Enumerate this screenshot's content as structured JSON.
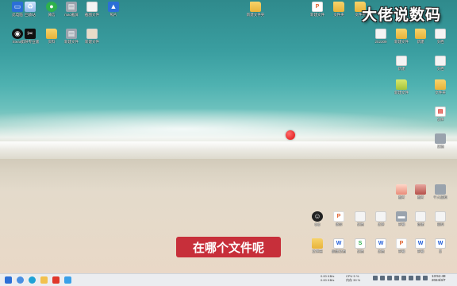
{
  "watermark": "大佬说数码",
  "subtitle": "在哪个文件呢",
  "desktop_icons": {
    "i01": {
      "label": "此电脑",
      "icon": "computer-icon"
    },
    "i02": {
      "label": "回收站",
      "icon": "recycle-bin-icon"
    },
    "i03": {
      "label": "微信",
      "icon": "wechat-icon"
    },
    "i04": {
      "label": "mac截屏",
      "icon": "screenshot-icon"
    },
    "i05": {
      "label": "截图文件",
      "icon": "document-icon"
    },
    "i06": {
      "label": "照片",
      "icon": "image-icon"
    },
    "i07": {
      "label": "新建文件夹",
      "icon": "folder-icon"
    },
    "i08": {
      "label": "新建文件",
      "icon": "ppt-icon"
    },
    "i09": {
      "label": "文件夹",
      "icon": "folder-icon"
    },
    "i10": {
      "label": "文件夹",
      "icon": "folder-icon"
    },
    "i11": {
      "label": "Steam",
      "icon": "steam-icon"
    },
    "i12": {
      "label": "剪映专业版",
      "icon": "capcut-icon"
    },
    "i13": {
      "label": "资料",
      "icon": "folder-icon"
    },
    "i14": {
      "label": "新建文件",
      "icon": "document-icon"
    },
    "i15": {
      "label": "新建文件",
      "icon": "document-icon"
    },
    "i16": {
      "label": "202309",
      "icon": "document-icon"
    },
    "i17": {
      "label": "新建文件",
      "icon": "folder-icon"
    },
    "i18": {
      "label": "新建",
      "icon": "document-icon"
    },
    "i19": {
      "label": "文档",
      "icon": "document-icon"
    },
    "i20": {
      "label": "新建文件",
      "icon": "folder-icon"
    },
    "i21": {
      "label": "文件",
      "icon": "pdf-icon"
    },
    "i22": {
      "label": "文件夹",
      "icon": "folder-icon"
    },
    "i23": {
      "label": "图片",
      "icon": "image-icon"
    },
    "i24": {
      "label": "个人资料",
      "icon": "image-icon"
    },
    "i25": {
      "label": "QQ",
      "icon": "qq-icon"
    },
    "i26": {
      "label": "演示",
      "icon": "ppt-icon"
    },
    "i27": {
      "label": "文档",
      "icon": "document-icon"
    },
    "i28": {
      "label": "文件",
      "icon": "document-icon"
    },
    "i29": {
      "label": "字幕",
      "icon": "document-icon"
    },
    "i30": {
      "label": "新建",
      "icon": "document-icon"
    },
    "i31": {
      "label": "资料",
      "icon": "document-icon"
    },
    "i32": {
      "label": "文件夹",
      "icon": "folder-icon"
    },
    "i33": {
      "label": "新建文档",
      "icon": "word-icon"
    },
    "i34": {
      "label": "文档",
      "icon": "word-icon"
    },
    "i35": {
      "label": "文档",
      "icon": "word-icon"
    },
    "i36": {
      "label": "字幕",
      "icon": "ppt-icon"
    },
    "i37": {
      "label": "字幕",
      "icon": "word-icon"
    },
    "i38": {
      "label": "文",
      "icon": "word-icon"
    }
  },
  "taskbar": {
    "net_up": "0.00 KB/s",
    "net_down": "0.00 KB/s",
    "cpu": "CPU 5 %",
    "mem": "内存 39 %",
    "time": "13:51:48",
    "date": "2024/3/7"
  },
  "colors": {
    "accent": "#c72f3a",
    "taskbar": "#ebeef2"
  }
}
